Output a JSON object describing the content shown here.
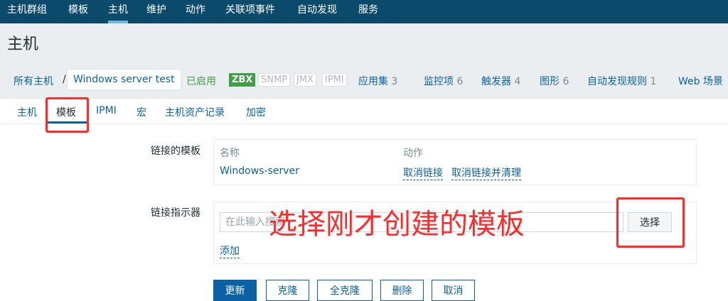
{
  "topnav": {
    "items": [
      "主机群组",
      "模板",
      "主机",
      "维护",
      "动作",
      "关联项事件",
      "自动发现",
      "服务"
    ],
    "active_index": 2
  },
  "page": {
    "title": "主机"
  },
  "breadcrumb": {
    "all_hosts": "所有主机",
    "separator": "/",
    "current_host": "Windows server test",
    "status": "已启用"
  },
  "availability": [
    "ZBX",
    "SNMP",
    "JMX",
    "IPMI"
  ],
  "host_links": [
    {
      "label": "应用集",
      "count": "3"
    },
    {
      "label": "监控项",
      "count": "6"
    },
    {
      "label": "触发器",
      "count": "4"
    },
    {
      "label": "图形",
      "count": "6"
    },
    {
      "label": "自动发现规则",
      "count": "1"
    },
    {
      "label": "Web 场景",
      "count": ""
    }
  ],
  "tabs": [
    "主机",
    "模板",
    "IPMI",
    "宏",
    "主机资产记录",
    "加密"
  ],
  "active_tab_index": 1,
  "form": {
    "linked_templates_label": "链接的模板",
    "table_headers": {
      "name": "名称",
      "action": "动作"
    },
    "template_row": {
      "name": "Windows-server",
      "unlink": "取消链接",
      "unlink_clear": "取消链接并清理"
    },
    "link_indicator_label": "链接指示器",
    "indicator_placeholder": "在此输入搜索",
    "select_button": "选择",
    "add_link": "添加"
  },
  "buttons": {
    "update": "更新",
    "clone": "克隆",
    "full_clone": "全克隆",
    "delete": "删除",
    "cancel": "取消"
  },
  "annotation": {
    "text": "选择刚才创建的模板",
    "color": "#ff2a2a"
  },
  "colors": {
    "nav_bg": "#0b4a6a",
    "link": "#0a62a4",
    "enabled": "#429e47"
  }
}
